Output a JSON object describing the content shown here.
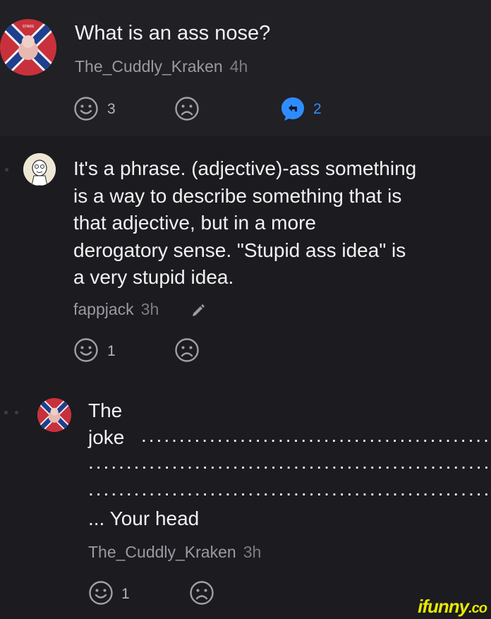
{
  "post": {
    "title": "What is an ass nose?",
    "author": "The_Cuddly_Kraken",
    "time": "4h",
    "likes": "3",
    "replies": "2",
    "avatar_icon": "confederate-flag-avatar"
  },
  "comments": [
    {
      "author": "fappjack",
      "time": "3h",
      "lines": [
        "It's a phrase. (adjective)-ass something",
        "is a way to describe something that is",
        "that adjective, but in a more",
        "derogatory sense. \"Stupid ass idea\" is",
        "a very stupid idea."
      ],
      "likes": "1",
      "edit_icon": "pencil-icon",
      "avatar_icon": "cartoon-face-avatar"
    },
    {
      "author": "The_Cuddly_Kraken",
      "time": "3h",
      "line1": "The",
      "line2": "joke",
      "line5": "... Your head",
      "likes": "1",
      "avatar_icon": "confederate-flag-avatar"
    }
  ],
  "colors": {
    "background": "#1b1b20",
    "post_background": "#202025",
    "reply_accent": "#2f8cff",
    "muted_text": "#9a9aa2"
  },
  "watermark": {
    "text": "ifunny",
    "suffix": ".co"
  }
}
